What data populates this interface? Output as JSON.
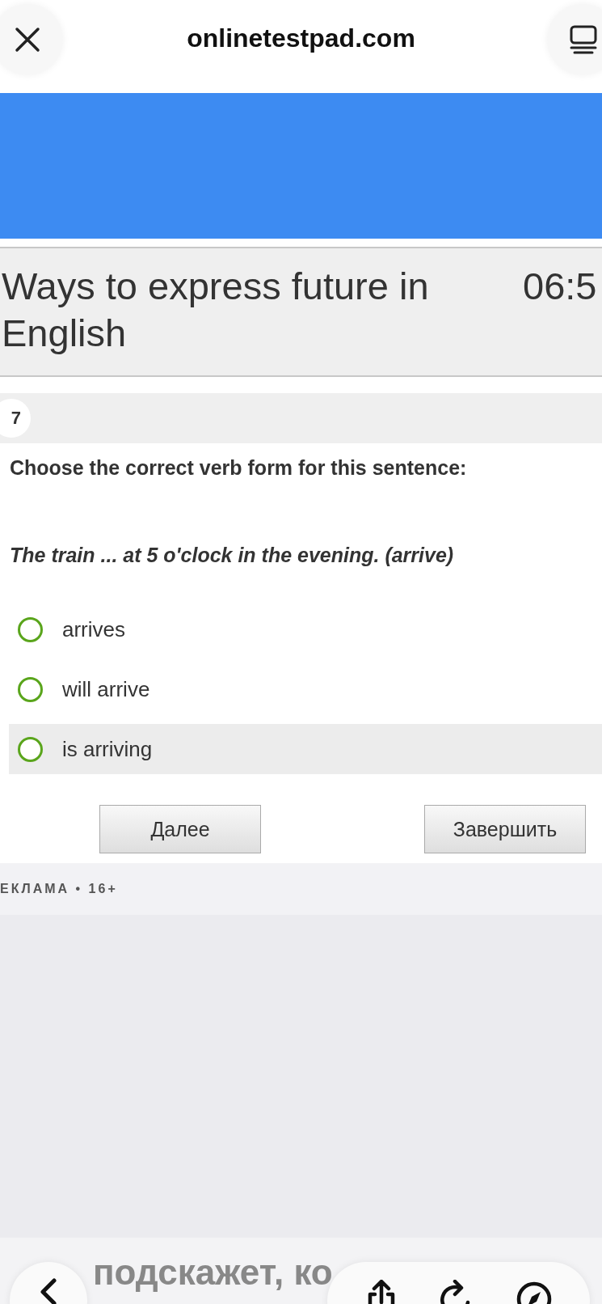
{
  "browser": {
    "domain": "onlinetestpad.com"
  },
  "test": {
    "title": "Ways to express future in English",
    "timer": "06:5"
  },
  "question": {
    "number": "7",
    "prompt": "Choose the correct verb form for this sentence:",
    "sentence": "The train ... at 5 o'clock in the evening. (arrive)",
    "options": [
      {
        "label": "arrives",
        "selected": false,
        "highlighted": false
      },
      {
        "label": "will arrive",
        "selected": false,
        "highlighted": false
      },
      {
        "label": "is arriving",
        "selected": false,
        "highlighted": true
      }
    ]
  },
  "buttons": [
    {
      "label": "Далее"
    },
    {
      "label": "Завершить"
    }
  ],
  "ad": {
    "label": "ЕКЛАМА • 16+",
    "bottom_text": "подскажет, ко"
  }
}
